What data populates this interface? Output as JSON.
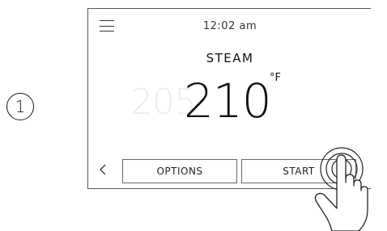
{
  "step": {
    "number": "1"
  },
  "screen": {
    "time": "12:02 am",
    "mode": "STEAM",
    "previous_temp": "205",
    "current_temp": "210",
    "unit": "°F"
  },
  "buttons": {
    "options_label": "OPTIONS",
    "start_label": "START"
  },
  "icons": [
    "menu-icon",
    "back-arrow-icon",
    "hand-tap-icon"
  ]
}
